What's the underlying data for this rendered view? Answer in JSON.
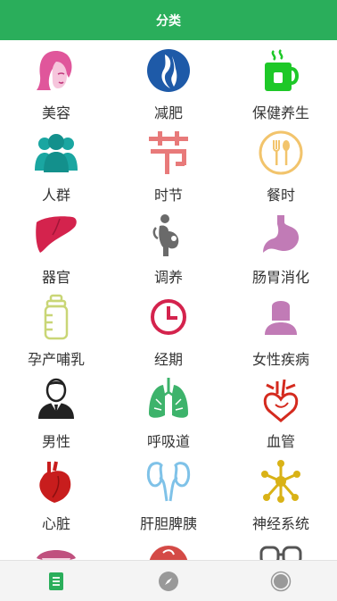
{
  "header": {
    "title": "分类"
  },
  "categories": [
    {
      "label": "美容",
      "icon": "woman-face-icon",
      "color": "#e0569b"
    },
    {
      "label": "减肥",
      "icon": "body-silhouette-icon",
      "color": "#1e5aa8"
    },
    {
      "label": "保健养生",
      "icon": "tea-cup-icon",
      "color": "#1ec828"
    },
    {
      "label": "人群",
      "icon": "people-group-icon",
      "color": "#1aa6a1"
    },
    {
      "label": "时节",
      "icon": "festival-char-icon",
      "color": "#e87a7a"
    },
    {
      "label": "餐时",
      "icon": "fork-spoon-icon",
      "color": "#f2c46c"
    },
    {
      "label": "器官",
      "icon": "liver-icon",
      "color": "#d4234d"
    },
    {
      "label": "调养",
      "icon": "pregnant-figure-icon",
      "color": "#6a6a6a"
    },
    {
      "label": "肠胃消化",
      "icon": "stomach-icon",
      "color": "#c17bb6"
    },
    {
      "label": "孕产哺乳",
      "icon": "baby-bottle-icon",
      "color": "#c9d676"
    },
    {
      "label": "经期",
      "icon": "clock-icon",
      "color": "#d4234d"
    },
    {
      "label": "女性疾病",
      "icon": "woman-bust-icon",
      "color": "#c17bb6"
    },
    {
      "label": "男性",
      "icon": "man-suit-icon",
      "color": "#222222"
    },
    {
      "label": "呼吸道",
      "icon": "lungs-icon",
      "color": "#3db36b"
    },
    {
      "label": "血管",
      "icon": "heart-vessels-icon",
      "color": "#d42a1e"
    },
    {
      "label": "心脏",
      "icon": "heart-organ-icon",
      "color": "#c81d1d"
    },
    {
      "label": "肝胆脾胰",
      "icon": "kidneys-icon",
      "color": "#7fc2e8"
    },
    {
      "label": "神经系统",
      "icon": "neuron-icon",
      "color": "#d9b216"
    },
    {
      "label": "",
      "icon": "mouth-icon",
      "color": "#c0507e"
    },
    {
      "label": "",
      "icon": "red-circle-icon",
      "color": "#d44a46"
    },
    {
      "label": "",
      "icon": "glasses-icon",
      "color": "#555555"
    }
  ],
  "tabbar": {
    "items": [
      {
        "icon": "list-icon",
        "color": "#2aae5b"
      },
      {
        "icon": "compass-icon",
        "color": "#999999"
      },
      {
        "icon": "user-circle-icon",
        "color": "#999999"
      }
    ]
  }
}
